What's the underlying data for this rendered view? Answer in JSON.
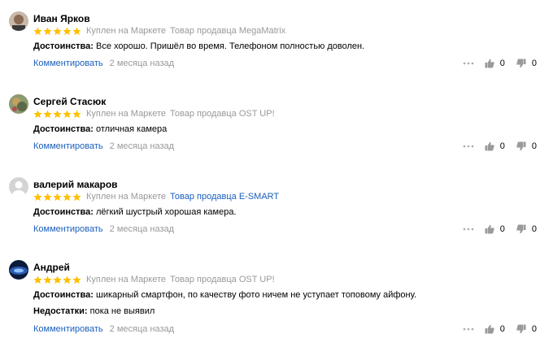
{
  "reviews": [
    {
      "author": "Иван Ярков",
      "badge": "Куплен на Маркете",
      "seller": "Товар продавца MegaMatrix",
      "seller_is_link": false,
      "pros_label": "Достоинства:",
      "pros": "Все хорошо. Пришёл во время. Телефоном полностью доволен.",
      "cons_label": "",
      "cons": "",
      "comment": "Комментировать",
      "date": "2 месяца назад",
      "likes": "0",
      "dislikes": "0",
      "rating": 5,
      "avatar_color": "#6a5a50"
    },
    {
      "author": "Сергей Стасюк",
      "badge": "Куплен на Маркете",
      "seller": "Товар продавца OST UP!",
      "seller_is_link": false,
      "pros_label": "Достоинства:",
      "pros": "отличная камера",
      "cons_label": "",
      "cons": "",
      "comment": "Комментировать",
      "date": "2 месяца назад",
      "likes": "0",
      "dislikes": "0",
      "rating": 5,
      "avatar_color": "#7a8a60"
    },
    {
      "author": "валерий макаров",
      "badge": "Куплен на Маркете",
      "seller": "Товар продавца E-SMART",
      "seller_is_link": true,
      "pros_label": "Достоинства:",
      "pros": "лёгкий шустрый хорошая камера.",
      "cons_label": "",
      "cons": "",
      "comment": "Комментировать",
      "date": "2 месяца назад",
      "likes": "0",
      "dislikes": "0",
      "rating": 5,
      "avatar_color": "#cccccc"
    },
    {
      "author": "Андрей",
      "badge": "Куплен на Маркете",
      "seller": "Товар продавца OST UP!",
      "seller_is_link": false,
      "pros_label": "Достоинства:",
      "pros": "шикарный смартфон, по качеству фото ничем не уступает топовому айфону.",
      "cons_label": "Недостатки:",
      "cons": "пока не выявил",
      "comment": "Комментировать",
      "date": "2 месяца назад",
      "likes": "0",
      "dislikes": "0",
      "rating": 5,
      "avatar_color": "#1a2e5a"
    }
  ],
  "colors": {
    "star": "#fec000",
    "link": "#1a5fbd",
    "muted": "#999999"
  }
}
